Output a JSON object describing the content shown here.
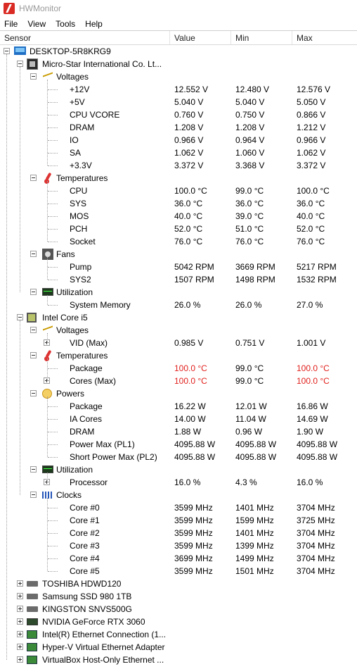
{
  "window": {
    "title": "HWMonitor"
  },
  "menu": [
    "File",
    "View",
    "Tools",
    "Help"
  ],
  "columns": [
    "Sensor",
    "Value",
    "Min",
    "Max"
  ],
  "tree": [
    {
      "level": 0,
      "type": "group",
      "label": "DESKTOP-5R8KRG9",
      "icon": "monitor-icon",
      "expanded": true
    },
    {
      "level": 1,
      "type": "group",
      "label": "Micro-Star International Co. Lt...",
      "icon": "motherboard-icon",
      "expanded": true
    },
    {
      "level": 2,
      "type": "group",
      "label": "Voltages",
      "icon": "voltage-icon",
      "expanded": true
    },
    {
      "level": 3,
      "type": "sensor",
      "label": "+12V",
      "value": "12.552 V",
      "min": "12.480 V",
      "max": "12.576 V"
    },
    {
      "level": 3,
      "type": "sensor",
      "label": "+5V",
      "value": "5.040 V",
      "min": "5.040 V",
      "max": "5.050 V"
    },
    {
      "level": 3,
      "type": "sensor",
      "label": "CPU VCORE",
      "value": "0.760 V",
      "min": "0.750 V",
      "max": "0.866 V"
    },
    {
      "level": 3,
      "type": "sensor",
      "label": "DRAM",
      "value": "1.208 V",
      "min": "1.208 V",
      "max": "1.212 V"
    },
    {
      "level": 3,
      "type": "sensor",
      "label": "IO",
      "value": "0.966 V",
      "min": "0.964 V",
      "max": "0.966 V"
    },
    {
      "level": 3,
      "type": "sensor",
      "label": "SA",
      "value": "1.062 V",
      "min": "1.060 V",
      "max": "1.062 V"
    },
    {
      "level": 3,
      "type": "sensor",
      "label": "+3.3V",
      "value": "3.372 V",
      "min": "3.368 V",
      "max": "3.372 V"
    },
    {
      "level": 2,
      "type": "group",
      "label": "Temperatures",
      "icon": "thermometer-icon",
      "expanded": true
    },
    {
      "level": 3,
      "type": "sensor",
      "label": "CPU",
      "value": "100.0 °C",
      "min": "99.0 °C",
      "max": "100.0 °C"
    },
    {
      "level": 3,
      "type": "sensor",
      "label": "SYS",
      "value": "36.0 °C",
      "min": "36.0 °C",
      "max": "36.0 °C"
    },
    {
      "level": 3,
      "type": "sensor",
      "label": "MOS",
      "value": "40.0 °C",
      "min": "39.0 °C",
      "max": "40.0 °C"
    },
    {
      "level": 3,
      "type": "sensor",
      "label": "PCH",
      "value": "52.0 °C",
      "min": "51.0 °C",
      "max": "52.0 °C"
    },
    {
      "level": 3,
      "type": "sensor",
      "label": "Socket",
      "value": "76.0 °C",
      "min": "76.0 °C",
      "max": "76.0 °C"
    },
    {
      "level": 2,
      "type": "group",
      "label": "Fans",
      "icon": "fan-icon",
      "expanded": true
    },
    {
      "level": 3,
      "type": "sensor",
      "label": "Pump",
      "value": "5042 RPM",
      "min": "3669 RPM",
      "max": "5217 RPM"
    },
    {
      "level": 3,
      "type": "sensor",
      "label": "SYS2",
      "value": "1507 RPM",
      "min": "1498 RPM",
      "max": "1532 RPM"
    },
    {
      "level": 2,
      "type": "group",
      "label": "Utilization",
      "icon": "utilization-icon",
      "expanded": true,
      "last": true
    },
    {
      "level": 3,
      "type": "sensor",
      "label": "System Memory",
      "value": "26.0 %",
      "min": "26.0 %",
      "max": "27.0 %"
    },
    {
      "level": 1,
      "type": "group",
      "label": "Intel Core i5",
      "icon": "cpu-icon",
      "expanded": true
    },
    {
      "level": 2,
      "type": "group",
      "label": "Voltages",
      "icon": "voltage-icon",
      "expanded": true
    },
    {
      "level": 3,
      "type": "sensor",
      "label": "VID (Max)",
      "value": "0.985 V",
      "min": "0.751 V",
      "max": "1.001 V",
      "expander": "plus"
    },
    {
      "level": 2,
      "type": "group",
      "label": "Temperatures",
      "icon": "thermometer-icon",
      "expanded": true
    },
    {
      "level": 3,
      "type": "sensor",
      "label": "Package",
      "value": "100.0 °C",
      "min": "99.0 °C",
      "max": "100.0 °C",
      "alert": true
    },
    {
      "level": 3,
      "type": "sensor",
      "label": "Cores (Max)",
      "value": "100.0 °C",
      "min": "99.0 °C",
      "max": "100.0 °C",
      "alert": true,
      "expander": "plus"
    },
    {
      "level": 2,
      "type": "group",
      "label": "Powers",
      "icon": "power-icon",
      "expanded": true
    },
    {
      "level": 3,
      "type": "sensor",
      "label": "Package",
      "value": "16.22 W",
      "min": "12.01 W",
      "max": "16.86 W"
    },
    {
      "level": 3,
      "type": "sensor",
      "label": "IA Cores",
      "value": "14.00 W",
      "min": "11.04 W",
      "max": "14.69 W"
    },
    {
      "level": 3,
      "type": "sensor",
      "label": "DRAM",
      "value": "1.88 W",
      "min": "0.96 W",
      "max": "1.90 W"
    },
    {
      "level": 3,
      "type": "sensor",
      "label": "Power Max (PL1)",
      "value": "4095.88 W",
      "min": "4095.88 W",
      "max": "4095.88 W"
    },
    {
      "level": 3,
      "type": "sensor",
      "label": "Short Power Max (PL2)",
      "value": "4095.88 W",
      "min": "4095.88 W",
      "max": "4095.88 W"
    },
    {
      "level": 2,
      "type": "group",
      "label": "Utilization",
      "icon": "utilization-icon",
      "expanded": true
    },
    {
      "level": 3,
      "type": "sensor",
      "label": "Processor",
      "value": "16.0 %",
      "min": "4.3 %",
      "max": "16.0 %",
      "expander": "plus"
    },
    {
      "level": 2,
      "type": "group",
      "label": "Clocks",
      "icon": "clock-icon",
      "expanded": true,
      "last": true
    },
    {
      "level": 3,
      "type": "sensor",
      "label": "Core #0",
      "value": "3599 MHz",
      "min": "1401 MHz",
      "max": "3704 MHz"
    },
    {
      "level": 3,
      "type": "sensor",
      "label": "Core #1",
      "value": "3599 MHz",
      "min": "1599 MHz",
      "max": "3725 MHz"
    },
    {
      "level": 3,
      "type": "sensor",
      "label": "Core #2",
      "value": "3599 MHz",
      "min": "1401 MHz",
      "max": "3704 MHz"
    },
    {
      "level": 3,
      "type": "sensor",
      "label": "Core #3",
      "value": "3599 MHz",
      "min": "1399 MHz",
      "max": "3704 MHz"
    },
    {
      "level": 3,
      "type": "sensor",
      "label": "Core #4",
      "value": "3699 MHz",
      "min": "1499 MHz",
      "max": "3704 MHz"
    },
    {
      "level": 3,
      "type": "sensor",
      "label": "Core #5",
      "value": "3599 MHz",
      "min": "1501 MHz",
      "max": "3704 MHz"
    },
    {
      "level": 1,
      "type": "group",
      "label": "TOSHIBA HDWD120",
      "icon": "drive-icon",
      "expanded": false
    },
    {
      "level": 1,
      "type": "group",
      "label": "Samsung SSD 980 1TB",
      "icon": "drive-icon",
      "expanded": false
    },
    {
      "level": 1,
      "type": "group",
      "label": "KINGSTON SNVS500G",
      "icon": "drive-icon",
      "expanded": false
    },
    {
      "level": 1,
      "type": "group",
      "label": "NVIDIA GeForce RTX 3060",
      "icon": "gpu-icon",
      "expanded": false
    },
    {
      "level": 1,
      "type": "group",
      "label": "Intel(R) Ethernet Connection (1...",
      "icon": "network-icon",
      "expanded": false
    },
    {
      "level": 1,
      "type": "group",
      "label": "Hyper-V Virtual Ethernet Adapter",
      "icon": "network-icon",
      "expanded": false
    },
    {
      "level": 1,
      "type": "group",
      "label": "VirtualBox Host-Only Ethernet ...",
      "icon": "network-icon",
      "expanded": false
    }
  ],
  "colors": {
    "alert": "#e0201c",
    "title_text": "#9a9a9a",
    "app_icon": "#d92b24"
  }
}
